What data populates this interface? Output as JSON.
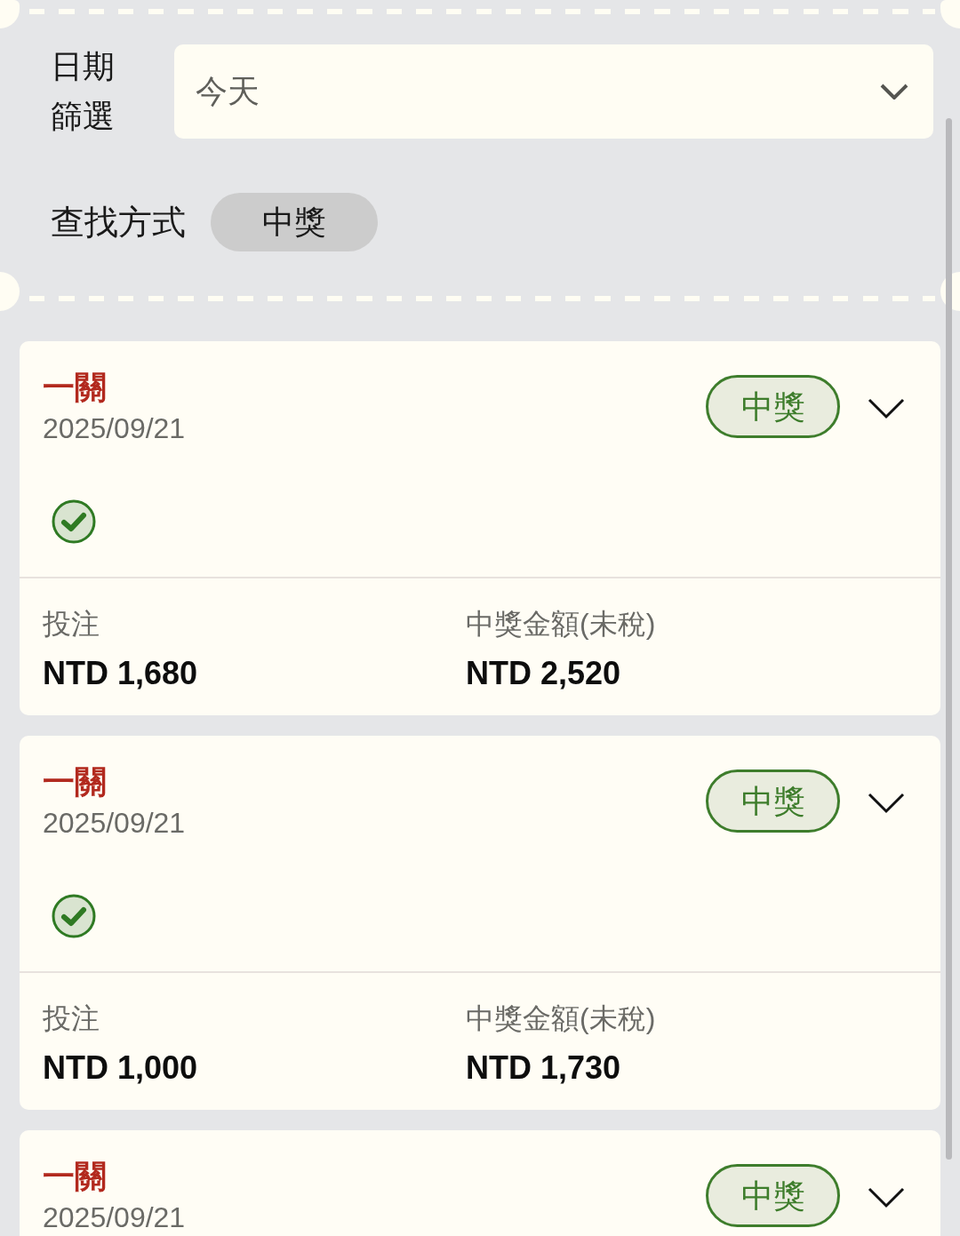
{
  "date_filter": {
    "label": "日期篩選",
    "value": "今天",
    "expanded": false
  },
  "search_method": {
    "label": "查找方式",
    "options": [
      {
        "label": "中獎",
        "selected": true
      }
    ]
  },
  "records": [
    {
      "title": "一關",
      "date": "2025/09/21",
      "status": "中獎",
      "expanded": false,
      "checked": true,
      "stake_label": "投注",
      "stake": "NTD 1,680",
      "payout_label": "中獎金額(未稅)",
      "payout": "NTD 2,520"
    },
    {
      "title": "一關",
      "date": "2025/09/21",
      "status": "中獎",
      "expanded": false,
      "checked": true,
      "stake_label": "投注",
      "stake": "NTD 1,000",
      "payout_label": "中獎金額(未稅)",
      "payout": "NTD 1,730"
    },
    {
      "title": "一關",
      "date": "2025/09/21",
      "status": "中獎",
      "expanded": false
    }
  ]
}
